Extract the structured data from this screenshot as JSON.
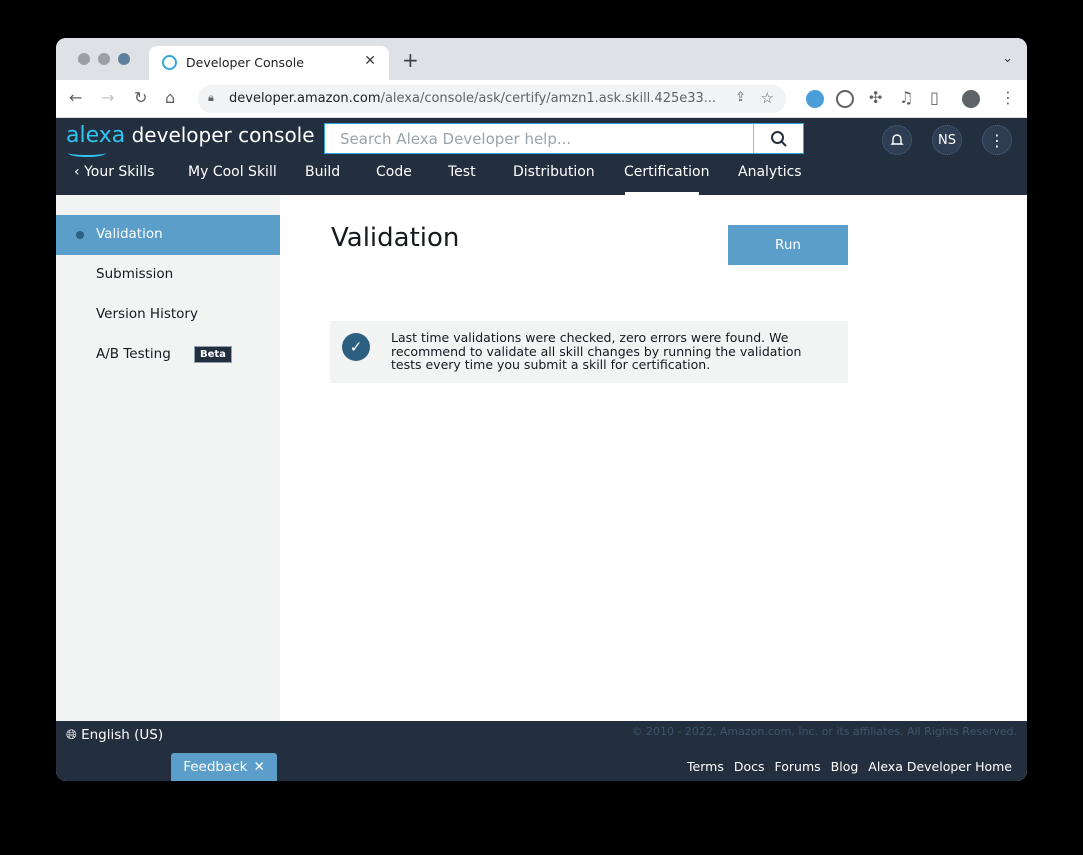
{
  "browser": {
    "tab_title": "Developer Console",
    "url_host": "developer.amazon.com",
    "url_path": "/alexa/console/ask/certify/amzn1.ask.skill.425e33...",
    "new_tab_symbol": "+"
  },
  "header": {
    "brand_alexa": "alexa",
    "brand_rest": " developer console",
    "search_placeholder": "Search Alexa Developer help...",
    "user_initials": "NS"
  },
  "nav": {
    "items": [
      "Your Skills",
      "My Cool Skill",
      "Build",
      "Code",
      "Test",
      "Distribution",
      "Certification",
      "Analytics"
    ],
    "active": "Certification"
  },
  "sidebar": {
    "items": [
      {
        "label": "Validation",
        "active": true
      },
      {
        "label": "Submission"
      },
      {
        "label": "Version History"
      },
      {
        "label": "A/B Testing",
        "badge": "Beta"
      }
    ]
  },
  "main": {
    "title": "Validation",
    "run_label": "Run",
    "alert_text": "Last time validations were checked, zero errors were found. We recommend to validate all skill changes by running the validation tests every time you submit a skill for certification."
  },
  "footer": {
    "language": "English (US)",
    "copyright": "© 2010 - 2022, Amazon.com, Inc. or its affiliates. All Rights Reserved.",
    "feedback_label": "Feedback",
    "links": [
      "Terms",
      "Docs",
      "Forums",
      "Blog",
      "Alexa Developer Home"
    ]
  },
  "colors": {
    "header_bg": "#232f3e",
    "accent": "#5a9ec9",
    "brand_blue": "#31c4f3"
  }
}
